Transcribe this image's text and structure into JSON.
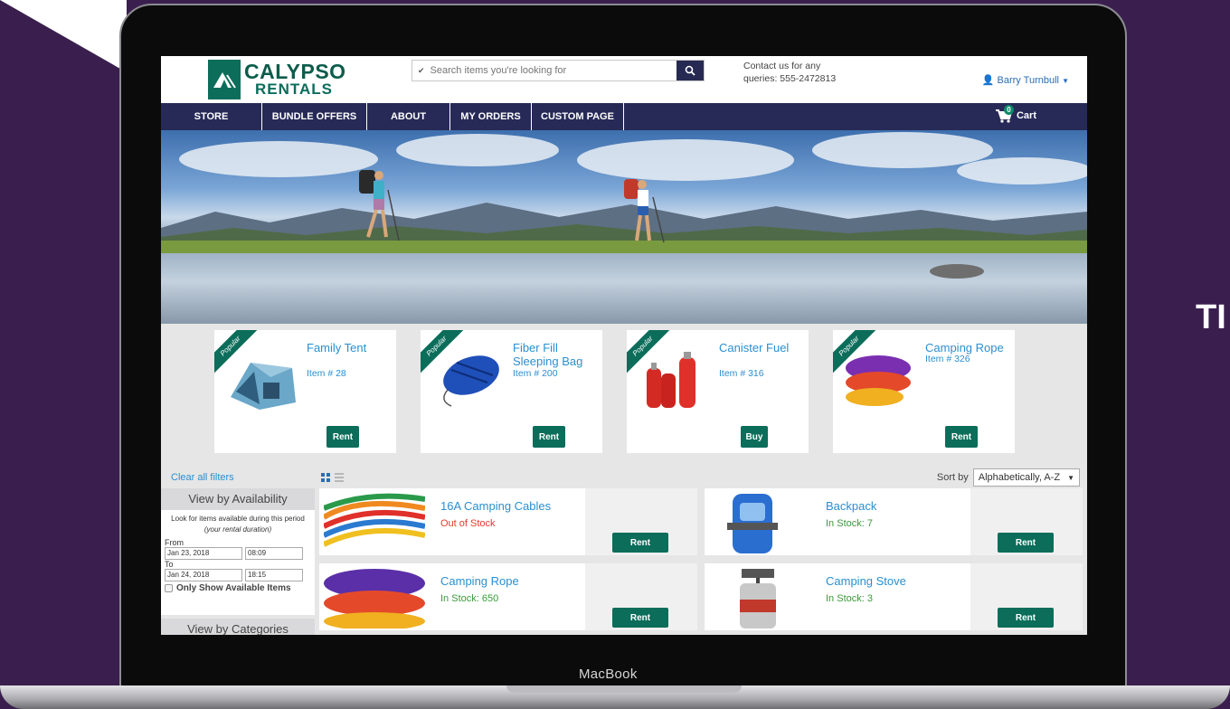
{
  "background": {
    "tail_text": "TI",
    "accent": "#3a1f4e"
  },
  "device": {
    "label": "MacBook"
  },
  "header": {
    "logo_line1": "CALYPSO",
    "logo_line2": "RENTALS",
    "search_placeholder": "Search items you're looking for",
    "contact": "Contact us for any queries: 555-2472813",
    "user_name": "Barry Turnbull",
    "brand_color": "#0b6d5a",
    "nav_color": "#272a57"
  },
  "nav": {
    "items": [
      "STORE",
      "BUNDLE OFFERS",
      "ABOUT",
      "MY ORDERS",
      "CUSTOM PAGE"
    ],
    "cart_label": "Cart",
    "cart_count": "0"
  },
  "featured": [
    {
      "ribbon": "Popular",
      "name": "Family Tent",
      "item": "Item # 28",
      "action": "Rent",
      "icon": "tent-icon"
    },
    {
      "ribbon": "Popular",
      "name": "Fiber Fill Sleeping Bag",
      "item": "Item # 200",
      "action": "Rent",
      "icon": "sleeping-bag-icon"
    },
    {
      "ribbon": "Popular",
      "name": "Canister Fuel",
      "item": "Item # 316",
      "action": "Buy",
      "icon": "fuel-bottle-icon"
    },
    {
      "ribbon": "Popular",
      "name": "Camping Rope",
      "item": "Item # 326",
      "action": "Rent",
      "icon": "rope-icon"
    }
  ],
  "toolbar": {
    "clear_filters": "Clear all filters",
    "sort_label": "Sort by",
    "sort_value": "Alphabetically, A-Z"
  },
  "sidebar": {
    "availability_title": "View by Availability",
    "note": "Look for items available during this period",
    "note_italic": "(your rental duration)",
    "from_label": "From",
    "from_date": "Jan 23, 2018",
    "from_time": "08:09",
    "to_label": "To",
    "to_date": "Jan 24, 2018",
    "to_time": "18:15",
    "only_available": "Only Show Available Items",
    "categories_title": "View by Categories"
  },
  "products": [
    {
      "name": "16A Camping Cables",
      "status": "Out of Stock",
      "status_color": "#e03b2a",
      "action": "Rent"
    },
    {
      "name": "Backpack",
      "status": "In Stock: 7",
      "status_color": "#3a9a3a",
      "action": "Rent"
    },
    {
      "name": "Camping Rope",
      "status": "In Stock: 650",
      "status_color": "#3a9a3a",
      "action": "Rent"
    },
    {
      "name": "Camping Stove",
      "status": "In Stock: 3",
      "status_color": "#3a9a3a",
      "action": "Rent"
    }
  ]
}
